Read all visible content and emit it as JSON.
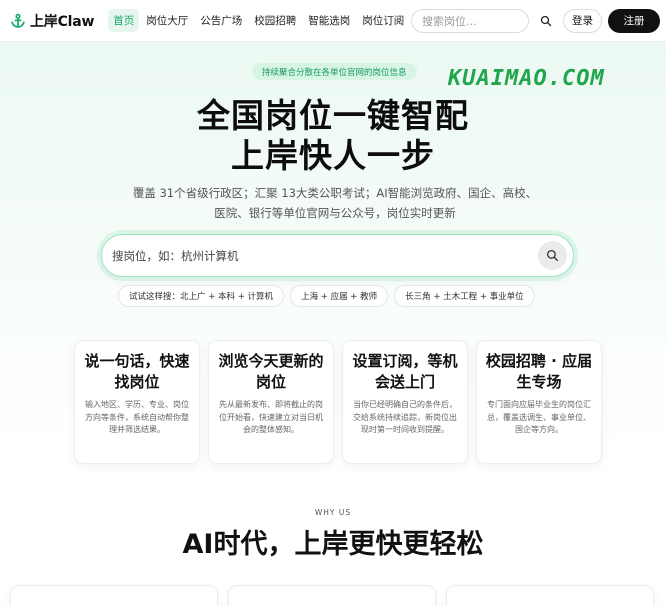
{
  "nav": {
    "brand": "上岸Claw",
    "links": [
      {
        "label": "首页",
        "active": true
      },
      {
        "label": "岗位大厅",
        "active": false
      },
      {
        "label": "公告广场",
        "active": false
      },
      {
        "label": "校园招聘",
        "active": false
      },
      {
        "label": "智能选岗",
        "active": false
      },
      {
        "label": "岗位订阅",
        "active": false
      }
    ],
    "search_placeholder": "搜索岗位...",
    "login_label": "登录",
    "register_label": "注册"
  },
  "hero": {
    "pill": "持续聚合分散在各单位官网的岗位信息",
    "watermark": "KUAIMAO.COM",
    "title_line1": "全国岗位一键智配",
    "title_line2": "上岸快人一步",
    "subtitle": "覆盖 31个省级行政区；汇聚 13大类公职考试；AI智能浏览政府、国企、高校、医院、银行等单位官网与公众号，岗位实时更新",
    "search_placeholder": "搜岗位，如：杭州计算机",
    "chips": [
      "试试这样搜：北上广 + 本科 + 计算机",
      "上海 + 应届 + 教师",
      "长三角 + 土木工程 + 事业单位"
    ]
  },
  "features": [
    {
      "title": "说一句话，快速找岗位",
      "desc": "输入地区、学历、专业、岗位方向等条件，系统自动帮你整理并筛选结果。"
    },
    {
      "title": "浏览今天更新的岗位",
      "desc": "先从最新发布、即将截止的岗位开始看，快速建立对当日机会的整体感知。"
    },
    {
      "title": "设置订阅，等机会送上门",
      "desc": "当你已经明确自己的条件后，交给系统持续追踪，新岗位出现时第一时间收到提醒。"
    },
    {
      "title": "校园招聘 · 应届生专场",
      "desc": "专门面向应届毕业生的岗位汇总，覆盖选调生、事业单位、国企等方向。"
    }
  ],
  "why": {
    "label": "WHY US",
    "title": "AI时代，上岸更快更轻松"
  },
  "colors": {
    "accent": "#16a86b",
    "pill_bg": "#d7f4e4",
    "dark_button": "#111111",
    "watermark": "#22a64d"
  },
  "icons": {
    "logo": "anchor-icon",
    "search": "search-icon"
  }
}
